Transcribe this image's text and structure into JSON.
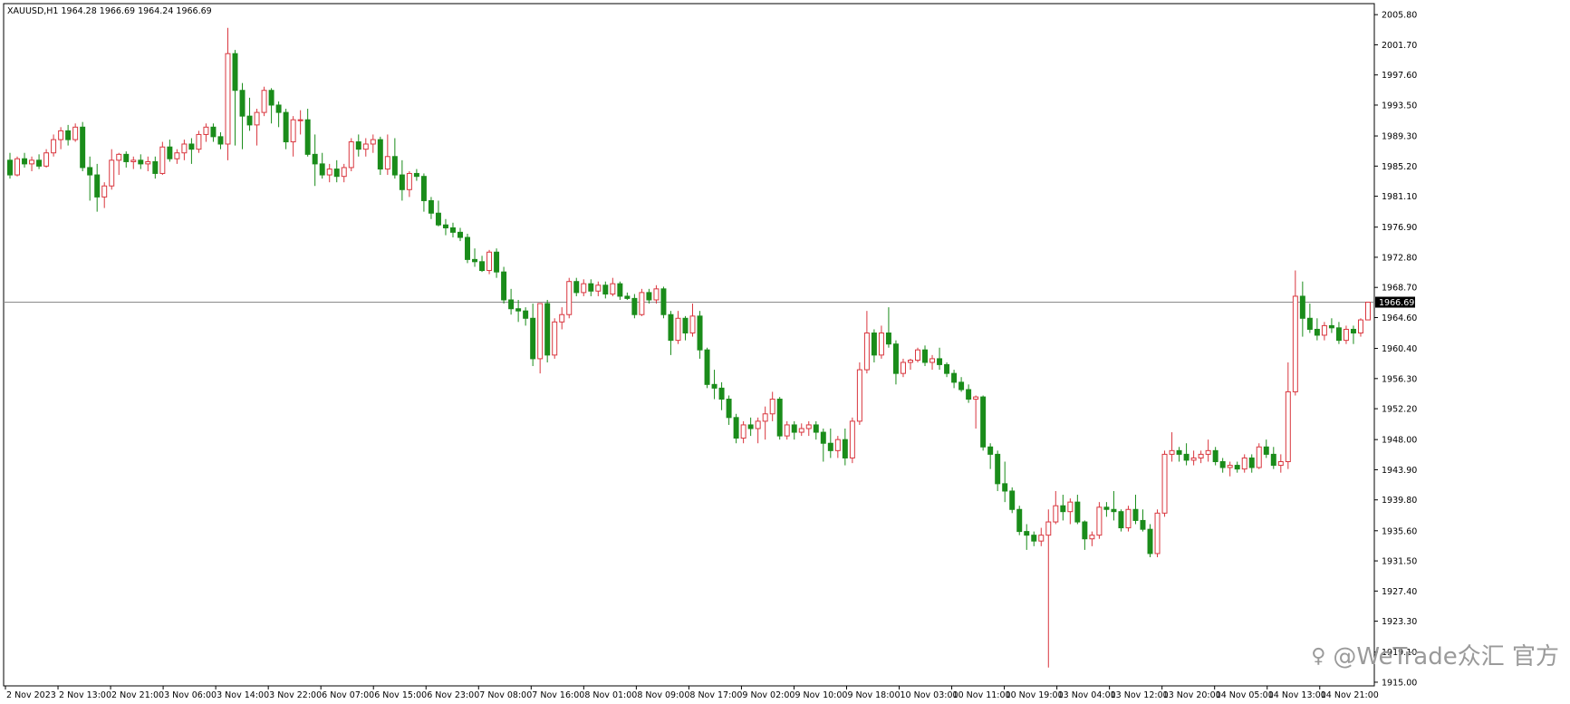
{
  "chart_window": {
    "symbol_info": "XAUUSD,H1  1964.28 1966.69 1964.24 1966.69",
    "watermark_text": "@WeTrade众汇 官方",
    "watermark_icon": "weibo-like-icon"
  },
  "colors": {
    "background": "#ffffff",
    "bull": "#d9363e",
    "bear": "#1a8c1a",
    "grid": "#000000",
    "price_line": "#8a8a8a",
    "price_label_bg": "#000000"
  },
  "chart_data": {
    "type": "candlestick",
    "symbol": "XAUUSD",
    "timeframe": "H1",
    "ylim": [
      1914.5,
      2007.3
    ],
    "current_price": 1966.69,
    "current_price_label": "1966.69",
    "y_ticks": [
      "2005.80",
      "2001.70",
      "1997.60",
      "1993.50",
      "1989.30",
      "1985.20",
      "1981.10",
      "1976.90",
      "1972.80",
      "1968.70",
      "1964.60",
      "1960.40",
      "1956.30",
      "1952.20",
      "1948.00",
      "1943.90",
      "1939.80",
      "1935.60",
      "1931.50",
      "1927.40",
      "1923.30",
      "1919.10",
      "1915.00"
    ],
    "x_ticks": [
      "2 Nov 2023",
      "2 Nov 13:00",
      "2 Nov 21:00",
      "3 Nov 06:00",
      "3 Nov 14:00",
      "3 Nov 22:00",
      "6 Nov 07:00",
      "6 Nov 15:00",
      "6 Nov 23:00",
      "7 Nov 08:00",
      "7 Nov 16:00",
      "8 Nov 01:00",
      "8 Nov 09:00",
      "8 Nov 17:00",
      "9 Nov 02:00",
      "9 Nov 10:00",
      "9 Nov 18:00",
      "10 Nov 03:00",
      "10 Nov 11:00",
      "10 Nov 19:00",
      "13 Nov 04:00",
      "13 Nov 12:00",
      "13 Nov 20:00",
      "14 Nov 05:00",
      "14 Nov 13:00",
      "14 Nov 21:00"
    ],
    "candles": [
      [
        1986.0,
        1987.0,
        1983.5,
        1984.0
      ],
      [
        1984.0,
        1986.5,
        1983.8,
        1986.2
      ],
      [
        1986.2,
        1987.0,
        1985.0,
        1985.5
      ],
      [
        1985.5,
        1986.5,
        1984.5,
        1986.0
      ],
      [
        1986.0,
        1986.8,
        1984.8,
        1985.2
      ],
      [
        1985.2,
        1987.5,
        1985.0,
        1987.0
      ],
      [
        1987.0,
        1989.5,
        1986.5,
        1988.8
      ],
      [
        1988.8,
        1990.5,
        1987.5,
        1990.0
      ],
      [
        1990.0,
        1990.8,
        1988.0,
        1988.8
      ],
      [
        1988.8,
        1991.0,
        1988.5,
        1990.5
      ],
      [
        1990.5,
        1991.2,
        1984.5,
        1985.0
      ],
      [
        1985.0,
        1986.5,
        1980.5,
        1984.0
      ],
      [
        1984.0,
        1985.5,
        1979.0,
        1981.0
      ],
      [
        1981.0,
        1983.0,
        1979.5,
        1982.5
      ],
      [
        1982.5,
        1987.5,
        1982.0,
        1986.0
      ],
      [
        1986.0,
        1987.0,
        1984.0,
        1986.8
      ],
      [
        1986.8,
        1987.2,
        1985.0,
        1985.8
      ],
      [
        1985.8,
        1986.5,
        1984.8,
        1986.0
      ],
      [
        1986.0,
        1986.8,
        1984.8,
        1985.5
      ],
      [
        1985.5,
        1986.5,
        1984.5,
        1985.8
      ],
      [
        1985.8,
        1986.5,
        1983.5,
        1984.2
      ],
      [
        1984.2,
        1988.5,
        1984.0,
        1987.8
      ],
      [
        1987.8,
        1988.8,
        1985.8,
        1986.2
      ],
      [
        1986.2,
        1987.5,
        1985.5,
        1987.0
      ],
      [
        1987.0,
        1988.8,
        1986.0,
        1988.2
      ],
      [
        1988.2,
        1989.0,
        1985.5,
        1987.5
      ],
      [
        1987.5,
        1990.0,
        1987.0,
        1989.5
      ],
      [
        1989.5,
        1991.0,
        1988.5,
        1990.5
      ],
      [
        1990.5,
        1991.0,
        1988.5,
        1989.2
      ],
      [
        1989.2,
        1989.8,
        1987.5,
        1988.2
      ],
      [
        1988.2,
        2004.0,
        1986.0,
        2000.5
      ],
      [
        2000.5,
        2001.0,
        1988.0,
        1995.5
      ],
      [
        1995.5,
        1996.5,
        1987.5,
        1992.0
      ],
      [
        1992.0,
        1994.5,
        1990.0,
        1990.8
      ],
      [
        1990.8,
        1993.0,
        1988.0,
        1992.5
      ],
      [
        1992.5,
        1996.0,
        1992.0,
        1995.5
      ],
      [
        1995.5,
        1995.8,
        1991.0,
        1993.5
      ],
      [
        1993.5,
        1994.0,
        1990.5,
        1992.5
      ],
      [
        1992.5,
        1993.0,
        1987.5,
        1988.5
      ],
      [
        1988.5,
        1992.0,
        1986.5,
        1991.5
      ],
      [
        1991.5,
        1992.8,
        1989.5,
        1991.5
      ],
      [
        1991.5,
        1993.0,
        1986.5,
        1986.8
      ],
      [
        1986.8,
        1989.5,
        1982.5,
        1985.5
      ],
      [
        1985.5,
        1987.0,
        1983.5,
        1984.0
      ],
      [
        1984.0,
        1985.5,
        1983.0,
        1984.8
      ],
      [
        1984.8,
        1986.0,
        1983.0,
        1983.8
      ],
      [
        1983.8,
        1985.5,
        1983.0,
        1985.0
      ],
      [
        1985.0,
        1989.0,
        1984.5,
        1988.5
      ],
      [
        1988.5,
        1989.5,
        1986.5,
        1987.5
      ],
      [
        1987.5,
        1989.0,
        1986.5,
        1988.2
      ],
      [
        1988.2,
        1989.5,
        1987.0,
        1988.8
      ],
      [
        1988.8,
        1989.2,
        1984.0,
        1984.8
      ],
      [
        1984.8,
        1989.5,
        1984.0,
        1986.5
      ],
      [
        1986.5,
        1989.0,
        1983.5,
        1984.0
      ],
      [
        1984.0,
        1986.0,
        1980.5,
        1982.0
      ],
      [
        1982.0,
        1984.5,
        1981.0,
        1984.2
      ],
      [
        1984.2,
        1984.8,
        1983.2,
        1983.8
      ],
      [
        1983.8,
        1984.2,
        1979.0,
        1980.5
      ],
      [
        1980.5,
        1981.0,
        1978.0,
        1978.8
      ],
      [
        1978.8,
        1980.5,
        1977.0,
        1977.2
      ],
      [
        1977.2,
        1978.0,
        1975.8,
        1976.8
      ],
      [
        1976.8,
        1977.5,
        1975.5,
        1976.2
      ],
      [
        1976.2,
        1976.8,
        1975.0,
        1975.5
      ],
      [
        1975.5,
        1976.0,
        1972.0,
        1972.5
      ],
      [
        1972.5,
        1974.0,
        1971.5,
        1972.2
      ],
      [
        1972.2,
        1973.0,
        1970.8,
        1971.0
      ],
      [
        1971.0,
        1973.8,
        1970.5,
        1973.5
      ],
      [
        1973.5,
        1974.0,
        1970.0,
        1970.8
      ],
      [
        1970.8,
        1971.5,
        1966.5,
        1967.0
      ],
      [
        1967.0,
        1968.5,
        1965.0,
        1965.8
      ],
      [
        1965.8,
        1967.0,
        1964.0,
        1965.5
      ],
      [
        1965.5,
        1966.0,
        1963.5,
        1964.5
      ],
      [
        1964.5,
        1966.5,
        1958.0,
        1959.0
      ],
      [
        1959.0,
        1965.5,
        1957.0,
        1966.5
      ],
      [
        1966.5,
        1967.0,
        1958.5,
        1959.5
      ],
      [
        1959.5,
        1964.5,
        1959.0,
        1964.0
      ],
      [
        1964.0,
        1966.0,
        1963.0,
        1965.0
      ],
      [
        1965.0,
        1970.0,
        1964.5,
        1969.5
      ],
      [
        1969.5,
        1970.0,
        1967.5,
        1968.0
      ],
      [
        1968.0,
        1969.8,
        1967.5,
        1969.2
      ],
      [
        1969.2,
        1969.8,
        1967.5,
        1968.2
      ],
      [
        1968.2,
        1969.5,
        1967.5,
        1969.0
      ],
      [
        1969.0,
        1969.5,
        1967.2,
        1967.8
      ],
      [
        1967.8,
        1970.0,
        1967.5,
        1969.2
      ],
      [
        1969.2,
        1969.5,
        1967.0,
        1967.5
      ],
      [
        1967.5,
        1968.0,
        1967.0,
        1967.2
      ],
      [
        1967.2,
        1967.8,
        1964.5,
        1965.0
      ],
      [
        1965.0,
        1968.5,
        1964.8,
        1968.0
      ],
      [
        1968.0,
        1968.5,
        1966.5,
        1967.0
      ],
      [
        1967.0,
        1969.0,
        1966.5,
        1968.5
      ],
      [
        1968.5,
        1968.8,
        1964.5,
        1965.0
      ],
      [
        1965.0,
        1965.5,
        1959.5,
        1961.5
      ],
      [
        1961.5,
        1965.5,
        1961.0,
        1964.5
      ],
      [
        1964.5,
        1964.8,
        1961.5,
        1962.5
      ],
      [
        1962.5,
        1966.5,
        1962.0,
        1964.8
      ],
      [
        1964.8,
        1965.5,
        1959.0,
        1960.2
      ],
      [
        1960.2,
        1960.5,
        1955.0,
        1955.5
      ],
      [
        1955.5,
        1957.5,
        1953.5,
        1955.0
      ],
      [
        1955.0,
        1955.8,
        1952.0,
        1953.5
      ],
      [
        1953.5,
        1954.0,
        1950.0,
        1951.0
      ],
      [
        1951.0,
        1951.5,
        1947.5,
        1948.2
      ],
      [
        1948.2,
        1950.5,
        1947.5,
        1950.0
      ],
      [
        1950.0,
        1951.0,
        1948.5,
        1949.5
      ],
      [
        1949.5,
        1951.0,
        1947.5,
        1950.5
      ],
      [
        1950.5,
        1952.5,
        1948.0,
        1951.5
      ],
      [
        1951.5,
        1954.5,
        1950.5,
        1953.5
      ],
      [
        1953.5,
        1953.8,
        1948.0,
        1948.5
      ],
      [
        1948.5,
        1950.5,
        1948.0,
        1950.0
      ],
      [
        1950.0,
        1950.5,
        1948.0,
        1949.0
      ],
      [
        1949.0,
        1950.2,
        1948.5,
        1949.5
      ],
      [
        1949.5,
        1950.5,
        1948.5,
        1950.0
      ],
      [
        1950.0,
        1950.5,
        1948.0,
        1949.0
      ],
      [
        1949.0,
        1949.5,
        1945.0,
        1947.5
      ],
      [
        1947.5,
        1949.5,
        1945.5,
        1946.5
      ],
      [
        1946.5,
        1948.5,
        1945.5,
        1948.0
      ],
      [
        1948.0,
        1949.5,
        1944.5,
        1945.5
      ],
      [
        1945.5,
        1951.0,
        1944.8,
        1950.5
      ],
      [
        1950.5,
        1958.5,
        1950.0,
        1957.5
      ],
      [
        1957.5,
        1965.5,
        1957.0,
        1962.5
      ],
      [
        1962.5,
        1963.0,
        1958.5,
        1959.5
      ],
      [
        1959.5,
        1963.5,
        1959.0,
        1962.5
      ],
      [
        1962.5,
        1966.0,
        1960.5,
        1961.0
      ],
      [
        1961.0,
        1961.5,
        1955.5,
        1957.0
      ],
      [
        1957.0,
        1959.0,
        1956.5,
        1958.5
      ],
      [
        1958.5,
        1959.0,
        1957.5,
        1958.8
      ],
      [
        1958.8,
        1960.5,
        1958.5,
        1960.2
      ],
      [
        1960.2,
        1960.8,
        1958.0,
        1958.5
      ],
      [
        1958.5,
        1959.5,
        1957.5,
        1959.0
      ],
      [
        1959.0,
        1960.5,
        1957.5,
        1958.2
      ],
      [
        1958.2,
        1958.5,
        1956.5,
        1957.0
      ],
      [
        1957.0,
        1957.5,
        1955.0,
        1955.8
      ],
      [
        1955.8,
        1956.5,
        1954.5,
        1954.8
      ],
      [
        1954.8,
        1955.5,
        1953.0,
        1953.5
      ],
      [
        1953.5,
        1954.0,
        1949.5,
        1953.8
      ],
      [
        1953.8,
        1954.0,
        1946.5,
        1947.0
      ],
      [
        1947.0,
        1947.5,
        1944.0,
        1946.0
      ],
      [
        1946.0,
        1946.5,
        1941.0,
        1942.0
      ],
      [
        1942.0,
        1945.0,
        1939.5,
        1941.0
      ],
      [
        1941.0,
        1941.5,
        1938.0,
        1938.5
      ],
      [
        1938.5,
        1939.0,
        1935.0,
        1935.5
      ],
      [
        1935.5,
        1936.5,
        1933.0,
        1935.0
      ],
      [
        1935.0,
        1935.5,
        1933.5,
        1934.2
      ],
      [
        1934.2,
        1936.0,
        1933.5,
        1935.0
      ],
      [
        1935.0,
        1938.5,
        1917.0,
        1936.8
      ],
      [
        1936.8,
        1941.0,
        1936.5,
        1939.0
      ],
      [
        1939.0,
        1940.5,
        1937.0,
        1938.2
      ],
      [
        1938.2,
        1940.0,
        1936.5,
        1939.5
      ],
      [
        1939.5,
        1940.5,
        1936.5,
        1936.8
      ],
      [
        1936.8,
        1937.0,
        1933.0,
        1934.5
      ],
      [
        1934.5,
        1935.5,
        1933.5,
        1935.0
      ],
      [
        1935.0,
        1939.5,
        1934.5,
        1938.8
      ],
      [
        1938.8,
        1939.5,
        1937.5,
        1938.5
      ],
      [
        1938.5,
        1941.0,
        1937.0,
        1938.2
      ],
      [
        1938.2,
        1938.5,
        1935.5,
        1936.0
      ],
      [
        1936.0,
        1939.0,
        1935.5,
        1938.5
      ],
      [
        1938.5,
        1940.5,
        1936.5,
        1937.0
      ],
      [
        1937.0,
        1938.5,
        1935.5,
        1935.8
      ],
      [
        1935.8,
        1936.5,
        1932.0,
        1932.5
      ],
      [
        1932.5,
        1938.5,
        1932.0,
        1938.0
      ],
      [
        1938.0,
        1946.5,
        1937.5,
        1946.0
      ],
      [
        1946.0,
        1949.0,
        1945.0,
        1946.5
      ],
      [
        1946.5,
        1947.0,
        1945.0,
        1946.0
      ],
      [
        1946.0,
        1947.5,
        1944.5,
        1945.2
      ],
      [
        1945.2,
        1946.5,
        1944.5,
        1945.5
      ],
      [
        1945.5,
        1946.5,
        1944.8,
        1946.0
      ],
      [
        1946.0,
        1948.0,
        1945.0,
        1946.5
      ],
      [
        1946.5,
        1947.0,
        1944.5,
        1945.0
      ],
      [
        1945.0,
        1945.5,
        1943.5,
        1944.2
      ],
      [
        1944.2,
        1945.0,
        1943.0,
        1944.5
      ],
      [
        1944.5,
        1945.0,
        1943.5,
        1944.0
      ],
      [
        1944.0,
        1946.0,
        1943.5,
        1945.5
      ],
      [
        1945.5,
        1946.0,
        1943.5,
        1944.2
      ],
      [
        1944.2,
        1947.5,
        1944.0,
        1947.0
      ],
      [
        1947.0,
        1948.0,
        1945.5,
        1946.0
      ],
      [
        1946.0,
        1947.0,
        1944.0,
        1944.5
      ],
      [
        1944.5,
        1946.0,
        1943.5,
        1945.0
      ],
      [
        1945.0,
        1958.5,
        1944.0,
        1954.5
      ],
      [
        1954.5,
        1971.0,
        1954.0,
        1967.5
      ],
      [
        1967.5,
        1969.5,
        1962.0,
        1964.5
      ],
      [
        1964.5,
        1966.5,
        1962.5,
        1963.0
      ],
      [
        1963.0,
        1964.5,
        1961.5,
        1962.2
      ],
      [
        1962.2,
        1964.0,
        1961.5,
        1963.5
      ],
      [
        1963.5,
        1964.5,
        1962.5,
        1963.2
      ],
      [
        1963.2,
        1964.0,
        1961.0,
        1961.5
      ],
      [
        1961.5,
        1963.5,
        1961.0,
        1963.0
      ],
      [
        1963.0,
        1963.5,
        1961.0,
        1962.5
      ],
      [
        1962.5,
        1964.5,
        1962.0,
        1964.28
      ],
      [
        1964.28,
        1966.69,
        1964.24,
        1966.69
      ]
    ]
  }
}
